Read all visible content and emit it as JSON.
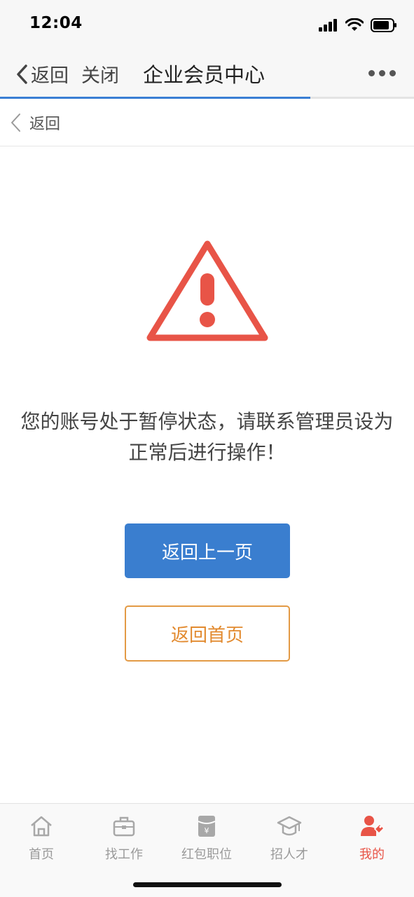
{
  "status_bar": {
    "time": "12:04",
    "icons": [
      "signal-icon",
      "wifi-icon",
      "battery-icon"
    ]
  },
  "nav_bar": {
    "back_label": "返回",
    "close_label": "关闭",
    "title": "企业会员中心",
    "more_icon": "more-icon",
    "page_load_progress": 0.75
  },
  "page_header": {
    "back_label": "返回"
  },
  "content": {
    "warning_icon": "warning-triangle-icon",
    "message_line1": "您的账号处于暂停状态，请联系管理员设为",
    "message_line2": "正常后进行操作！",
    "primary_button": "返回上一页",
    "secondary_button": "返回首页"
  },
  "tab_bar": {
    "items": [
      {
        "label": "首页",
        "icon": "home-icon",
        "active": false
      },
      {
        "label": "找工作",
        "icon": "briefcase-icon",
        "active": false
      },
      {
        "label": "红包职位",
        "icon": "red-envelope-icon",
        "active": false
      },
      {
        "label": "招人才",
        "icon": "graduation-cap-icon",
        "active": false
      },
      {
        "label": "我的",
        "icon": "user-tag-icon",
        "active": true
      }
    ]
  },
  "colors": {
    "accent_blue": "#3a7ecf",
    "warning_red": "#e85447",
    "secondary_orange": "#e28a2f",
    "active_tab": "#e85447"
  }
}
